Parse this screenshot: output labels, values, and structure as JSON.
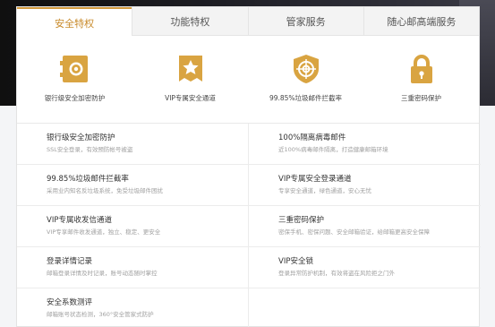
{
  "tabs": [
    {
      "label": "安全特权",
      "active": true
    },
    {
      "label": "功能特权",
      "active": false
    },
    {
      "label": "管家服务",
      "active": false
    },
    {
      "label": "随心邮高端服务",
      "active": false
    }
  ],
  "features": [
    {
      "label": "银行级安全加密防护",
      "icon": "safe-icon"
    },
    {
      "label": "VIP专属安全通道",
      "icon": "star-badge-icon"
    },
    {
      "label": "99.85%垃圾邮件拦截率",
      "icon": "target-shield-icon"
    },
    {
      "label": "三重密码保护",
      "icon": "padlock-icon"
    }
  ],
  "details": [
    {
      "title": "银行级安全加密防护",
      "desc": "SSL安全登录，有效预防帐号被盗"
    },
    {
      "title": "100%隔离病毒邮件",
      "desc": "近100%病毒邮件隔离，打造健康邮箱环境"
    },
    {
      "title": "99.85%垃圾邮件拦截率",
      "desc": "采用业内知名反垃圾系统，免受垃圾邮件困扰"
    },
    {
      "title": "VIP专属安全登录通道",
      "desc": "专享安全通道，绿色通道，安心无忧"
    },
    {
      "title": "VIP专属收发信通道",
      "desc": "VIP专享邮件收发通道，独立、稳定、更安全"
    },
    {
      "title": "三重密码保护",
      "desc": "密保手机、密保问题、安全邮箱验证，给邮箱更高安全保障"
    },
    {
      "title": "登录详情记录",
      "desc": "邮箱登录详情及时记录，账号动态随时掌控"
    },
    {
      "title": "VIP安全锁",
      "desc": "登录异常防护机制，有效将盗在风险拒之门外"
    },
    {
      "title": "安全系数测评",
      "desc": "邮箱账号状态检测，360°安全管家式防护"
    },
    {
      "title": "",
      "desc": ""
    }
  ],
  "colors": {
    "accent": "#d29a3c",
    "icon_gold": "#d9a441"
  }
}
